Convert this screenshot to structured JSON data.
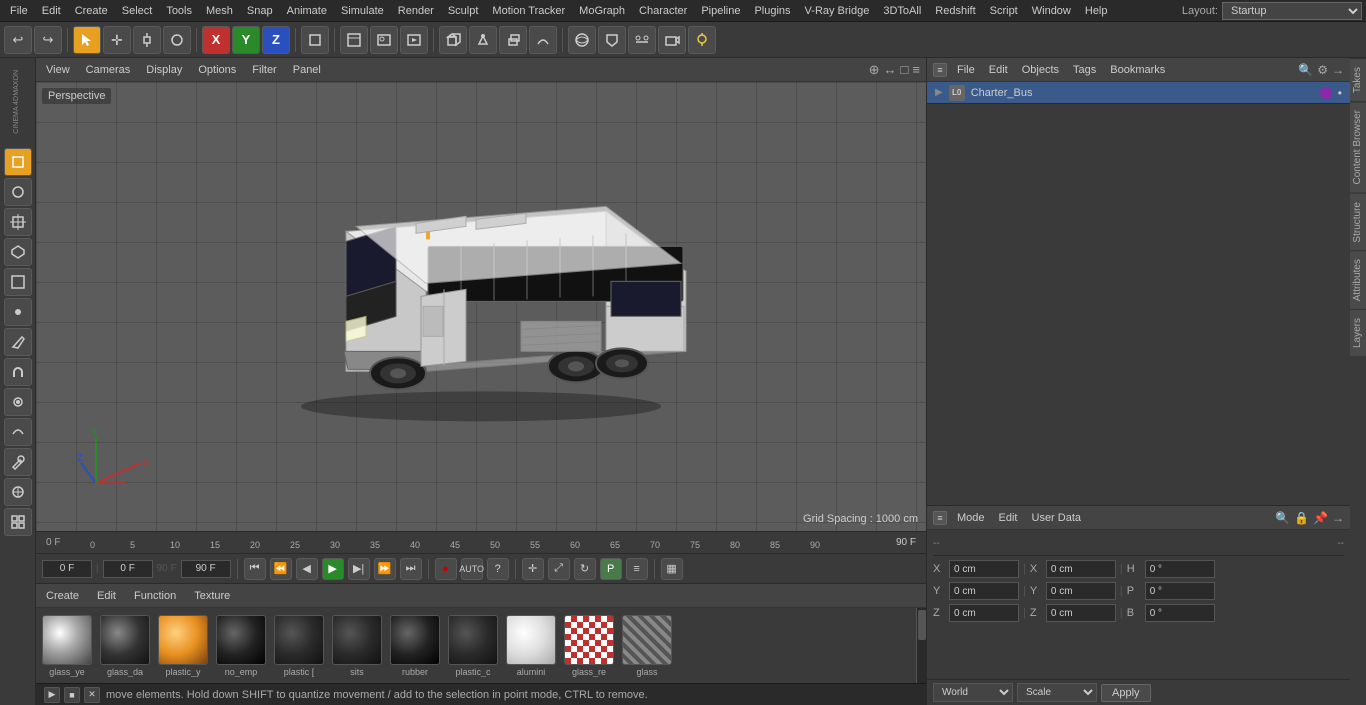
{
  "app": {
    "title": "Cinema 4D",
    "layout": "Startup"
  },
  "menubar": {
    "items": [
      "File",
      "Edit",
      "Create",
      "Select",
      "Tools",
      "Mesh",
      "Snap",
      "Animate",
      "Simulate",
      "Render",
      "Sculpt",
      "Motion Tracker",
      "MoGraph",
      "Character",
      "Pipeline",
      "Plugins",
      "V-Ray Bridge",
      "3DToAll",
      "Redshift",
      "Script",
      "Window",
      "Help"
    ]
  },
  "toolbar": {
    "undo_label": "↩",
    "redo_label": "↪"
  },
  "viewport": {
    "mode_label": "Perspective",
    "toolbar_items": [
      "View",
      "Cameras",
      "Display",
      "Options",
      "Filter",
      "Panel"
    ],
    "grid_spacing": "Grid Spacing : 1000 cm"
  },
  "timeline": {
    "current_frame": "0 F",
    "end_frame": "90 F",
    "ticks": [
      "0",
      "5",
      "10",
      "15",
      "20",
      "25",
      "30",
      "35",
      "40",
      "45",
      "50",
      "55",
      "60",
      "65",
      "70",
      "75",
      "80",
      "85",
      "90"
    ]
  },
  "playback": {
    "frame_start": "0 F",
    "frame_current": "0 F",
    "frame_end": "90 F",
    "frame_end2": "90 F"
  },
  "material_browser": {
    "toolbar_items": [
      "Create",
      "Edit",
      "Function",
      "Texture"
    ],
    "materials": [
      {
        "name": "glass_ye",
        "type": "glass-yellow"
      },
      {
        "name": "glass_da",
        "type": "glass-dark"
      },
      {
        "name": "plastic_y",
        "type": "plastic-orange"
      },
      {
        "name": "no_emp",
        "type": "black"
      },
      {
        "name": "plastic [",
        "type": "dark"
      },
      {
        "name": "sits",
        "type": "dark2"
      },
      {
        "name": "rubber",
        "type": "dark3"
      },
      {
        "name": "plastic_c",
        "type": "dark4"
      },
      {
        "name": "alumini",
        "type": "light"
      },
      {
        "name": "glass_re",
        "type": "red-checker"
      },
      {
        "name": "glass",
        "type": "stripe"
      }
    ]
  },
  "status_bar": {
    "message": "move elements. Hold down SHIFT to quantize movement / add to the selection in point mode, CTRL to remove."
  },
  "object_manager": {
    "toolbar_items": [
      "File",
      "Edit",
      "Objects",
      "Tags",
      "Bookmarks"
    ],
    "objects": [
      {
        "name": "Charter_Bus",
        "icon": "L0",
        "has_purple_dot": true,
        "has_extra": true
      }
    ]
  },
  "attributes": {
    "toolbar_items": [
      "Mode",
      "Edit",
      "User Data"
    ],
    "coords": {
      "x_pos": "0 cm",
      "y_pos": "0 cm",
      "z_pos": "0 cm",
      "x_rot": "0 °",
      "y_rot": "0 °",
      "z_rot": "0 °",
      "h_val": "0 °",
      "p_val": "0 °",
      "b_val": "0 °"
    },
    "coord_labels": {
      "x": "X",
      "y": "Y",
      "z": "Z"
    }
  },
  "coord_mode": {
    "world_label": "World",
    "scale_label": "Scale",
    "apply_label": "Apply"
  },
  "right_tabs": [
    "Takes",
    "Content Browser",
    "Structure",
    "Attributes",
    "Layers"
  ]
}
